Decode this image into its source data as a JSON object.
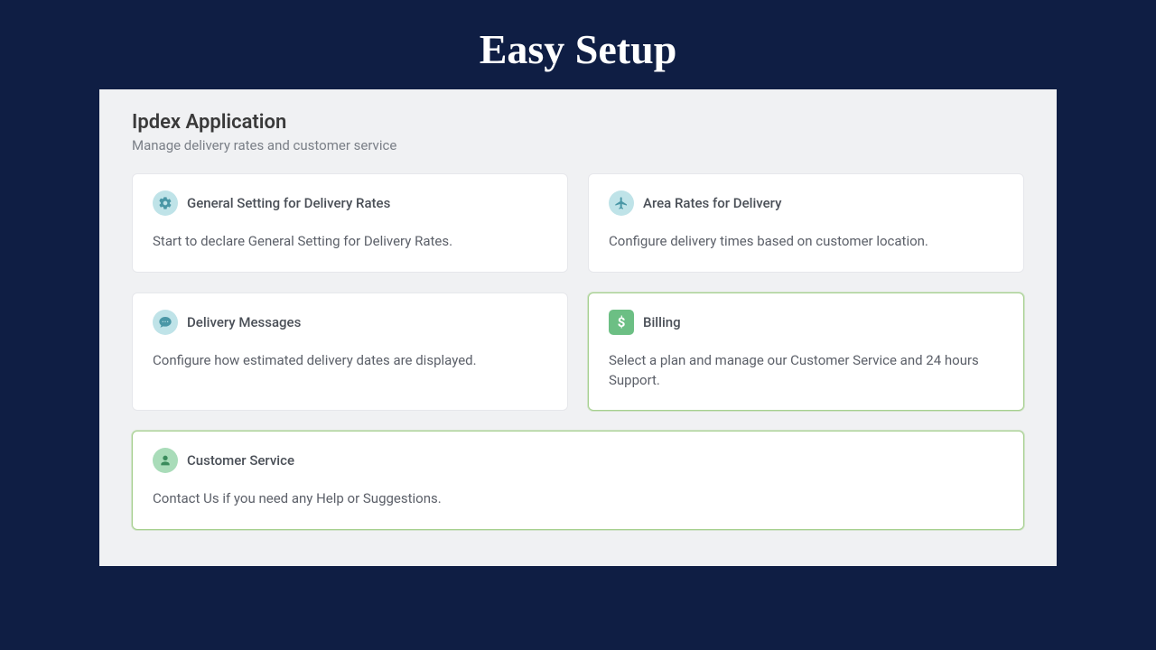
{
  "hero": {
    "title": "Easy Setup"
  },
  "page": {
    "title": "Ipdex Application",
    "subtitle": "Manage delivery rates and customer service"
  },
  "cards": [
    {
      "title": "General Setting for Delivery Rates",
      "desc": "Start to declare General Setting for Delivery Rates."
    },
    {
      "title": "Area Rates for Delivery",
      "desc": "Configure delivery times based on customer location."
    },
    {
      "title": "Delivery Messages",
      "desc": "Configure how estimated delivery dates are displayed."
    },
    {
      "title": "Billing",
      "desc": "Select a plan and manage our Customer Service and 24 hours Support."
    },
    {
      "title": "Customer Service",
      "desc": "Contact Us if you need any Help or Suggestions."
    }
  ],
  "icons": {
    "dollar": "$"
  }
}
